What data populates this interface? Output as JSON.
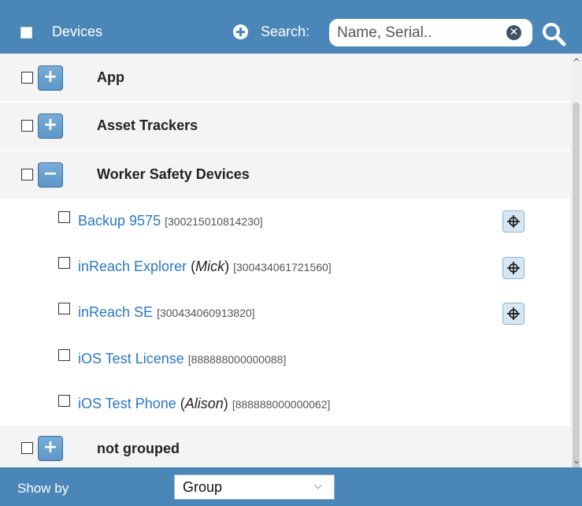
{
  "header": {
    "title": "Devices",
    "search_label": "Search:",
    "search_placeholder": "Name, Serial..",
    "search_value": "",
    "clear_glyph": "✕"
  },
  "groups": [
    {
      "label": "App",
      "button_glyph": "+",
      "expanded": false
    },
    {
      "label": "Asset Trackers",
      "button_glyph": "+",
      "expanded": false
    },
    {
      "label": "Worker Safety Devices",
      "button_glyph": "−",
      "expanded": true
    },
    {
      "label": "not grouped",
      "button_glyph": "+",
      "expanded": false
    }
  ],
  "devices": [
    {
      "name": "Backup 9575",
      "user": "",
      "serial": "[300215010814230]",
      "has_locate": true
    },
    {
      "name": "inReach Explorer",
      "user": "Mick",
      "serial": "[300434061721560]",
      "has_locate": true
    },
    {
      "name": "inReach SE",
      "user": "",
      "serial": "[300434060913820]",
      "has_locate": true
    },
    {
      "name": "iOS Test License",
      "user": "",
      "serial": "[888888000000088]",
      "has_locate": false
    },
    {
      "name": "iOS Test Phone",
      "user": "Alison",
      "serial": "[888888000000062]",
      "has_locate": false
    }
  ],
  "footer": {
    "show_by_label": "Show by",
    "show_by_value": "Group"
  },
  "icons": {
    "add": "plus-circle-icon",
    "search": "magnifier-icon",
    "clear": "clear-circle-icon",
    "locate": "crosshair-icon"
  },
  "colors": {
    "header_bg": "#4a86b8",
    "link": "#2a78c6",
    "group_bg": "#f4f4f4"
  }
}
